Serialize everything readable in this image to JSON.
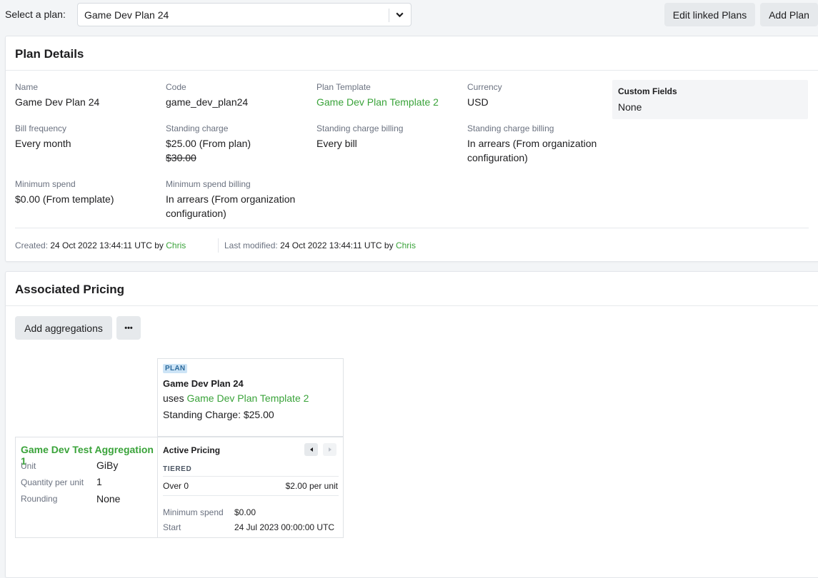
{
  "topbar": {
    "select_label": "Select a plan:",
    "selected_plan": "Game Dev Plan 24",
    "edit_linked_plans": "Edit linked Plans",
    "add_plan": "Add Plan"
  },
  "plan_details": {
    "title": "Plan Details",
    "fields": {
      "name": {
        "label": "Name",
        "value": "Game Dev Plan 24"
      },
      "code": {
        "label": "Code",
        "value": "game_dev_plan24"
      },
      "plan_template": {
        "label": "Plan Template",
        "value": "Game Dev Plan Template 2"
      },
      "currency": {
        "label": "Currency",
        "value": "USD"
      },
      "bill_frequency": {
        "label": "Bill frequency",
        "value": "Every month"
      },
      "standing_charge": {
        "label": "Standing charge",
        "value": "$25.00 (From plan)",
        "old_value": "$30.00"
      },
      "standing_charge_billing_1": {
        "label": "Standing charge billing",
        "value": "Every bill"
      },
      "standing_charge_billing_2": {
        "label": "Standing charge billing",
        "value_line1": "In arrears (From organization",
        "value_line2": "configuration)"
      },
      "minimum_spend": {
        "label": "Minimum spend",
        "value": "$0.00 (From template)"
      },
      "minimum_spend_billing": {
        "label": "Minimum spend billing",
        "value_line1": "In arrears (From organization",
        "value_line2": "configuration)"
      }
    },
    "custom_fields": {
      "title": "Custom Fields",
      "value": "None"
    },
    "created": {
      "key": "Created:",
      "value": "24 Oct 2022 13:44:11 UTC by",
      "user": "Chris"
    },
    "last_modified": {
      "key": "Last modified:",
      "value": "24 Oct 2022 13:44:11 UTC by",
      "user": "Chris"
    }
  },
  "associated_pricing": {
    "title": "Associated Pricing",
    "add_aggregations": "Add aggregations",
    "more": "•••",
    "plan": {
      "badge": "PLAN",
      "name": "Game Dev Plan 24",
      "uses_prefix": "uses",
      "uses_template": "Game Dev Plan Template 2",
      "standing_charge": "Standing Charge: $25.00"
    },
    "aggregation": {
      "name": "Game Dev Test Aggregation 1",
      "rows": [
        {
          "key": "Unit",
          "value": "GiBy"
        },
        {
          "key": "Quantity per unit",
          "value": "1"
        },
        {
          "key": "Rounding",
          "value": "None"
        }
      ]
    },
    "pricing": {
      "title": "Active Pricing",
      "type": "TIERED",
      "tier": {
        "left": "Over 0",
        "right": "$2.00 per unit"
      },
      "rows": [
        {
          "key": "Minimum spend",
          "value": "$0.00"
        },
        {
          "key": "Start",
          "value": "24 Jul 2023 00:00:00 UTC"
        }
      ]
    }
  },
  "colors": {
    "accent": "#3aa33a",
    "badge_bg": "#cde4f6",
    "button_bg": "#e6e9ec"
  }
}
